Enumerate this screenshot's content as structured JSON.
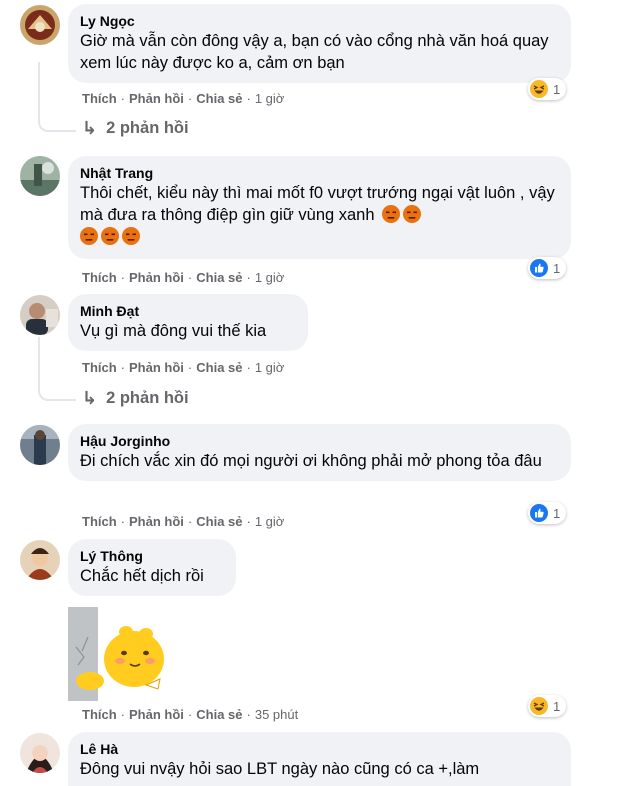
{
  "actions": {
    "like": "Thích",
    "reply": "Phản hồi",
    "share": "Chia sẻ",
    "separator": "·"
  },
  "comments": [
    {
      "author": "Ly Ngọc",
      "text": "Giờ mà vẫn còn đông vậy a, bạn có vào cổng nhà văn hoá quay xem lúc này được ko a, cảm ơn bạn",
      "time": "1 giờ",
      "reaction": {
        "type": "haha",
        "count": "1"
      },
      "replies": "2 phản hồi"
    },
    {
      "author": "Nhật Trang",
      "text": "Thôi chết, kiểu này thì mai mốt f0 vượt trướng ngại vật luôn , vậy mà đưa ra thông điệp gìn giữ vùng xanh",
      "emojis": [
        "angry",
        "angry",
        "angry",
        "angry",
        "angry"
      ],
      "time": "1 giờ",
      "reaction": {
        "type": "like",
        "count": "1"
      }
    },
    {
      "author": "Minh Đạt",
      "text": "Vụ gì mà đông vui thế kia",
      "time": "1 giờ",
      "replies": "2 phản hồi"
    },
    {
      "author": "Hậu Jorginho",
      "text": "Đi chích vắc xin đó mọi người ơi không phải mở phong tỏa đâu",
      "time": "1 giờ",
      "reaction": {
        "type": "like",
        "count": "1"
      }
    },
    {
      "author": "Lý Thông",
      "text": "Chắc hết dịch rồi",
      "time": "35 phút",
      "reaction": {
        "type": "haha",
        "count": "1"
      },
      "sticker": "sticker-yellow-bear"
    },
    {
      "author": "Lê Hà",
      "text": "Đông vui nvậy hỏi sao LBT ngày nào cũng có ca +,làm"
    }
  ],
  "colors": {
    "bubble": "#f0f2f5",
    "meta": "#65676b",
    "like_blue": "#1877f2",
    "angry": "#e9710f",
    "haha": "#f7b928"
  }
}
